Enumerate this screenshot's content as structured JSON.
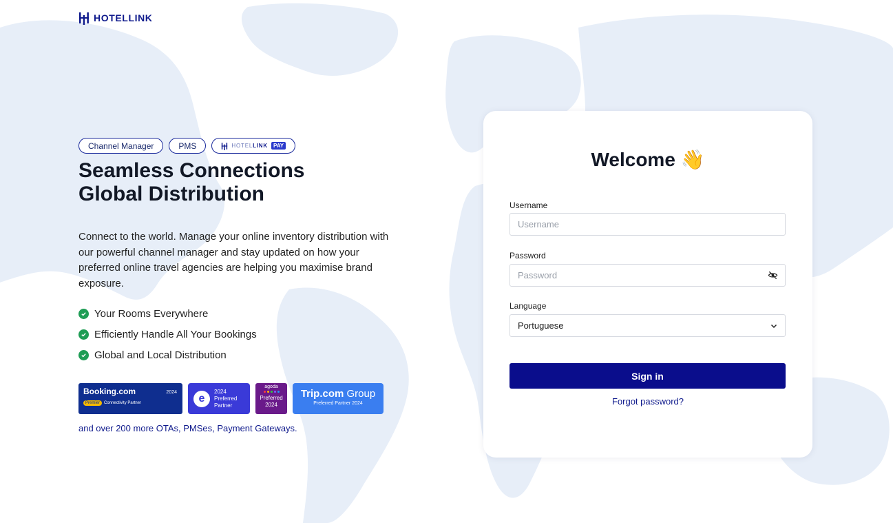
{
  "brand": {
    "name": "HOTELLINK"
  },
  "hero": {
    "pills": [
      "Channel Manager",
      "PMS"
    ],
    "pay_pill": {
      "brand_light": "HOTEL",
      "brand_bold": "LINK",
      "tag": "PAY"
    },
    "headline_line1": "Seamless Connections",
    "headline_line2": "Global Distribution",
    "description": "Connect to the world. Manage your online inventory distribution with our powerful channel manager and stay updated on how your preferred online travel agencies are helping you maximise brand exposure.",
    "features": [
      "Your Rooms Everywhere",
      "Efficiently Handle All Your Bookings",
      "Global and Local Distribution"
    ],
    "badges": {
      "booking": {
        "name": "Booking.com",
        "year": "2024",
        "tag": "Premier",
        "subtitle": "Connectivity Partner"
      },
      "expedia": {
        "letter": "e",
        "line1": "2024",
        "line2": "Preferred",
        "line3": "Partner"
      },
      "agoda": {
        "name": "agoda",
        "line1": "Preferred",
        "line2": "2024"
      },
      "trip": {
        "name_bold": "Trip.com",
        "name_light": " Group",
        "subtitle": "Preferred Partner 2024"
      }
    },
    "more_text": "and over 200 more OTAs, PMSes, Payment Gateways."
  },
  "login": {
    "title": "Welcome 👋",
    "username_label": "Username",
    "username_placeholder": "Username",
    "password_label": "Password",
    "password_placeholder": "Password",
    "language_label": "Language",
    "language_value": "Portuguese",
    "signin_label": "Sign in",
    "forgot_label": "Forgot password?"
  },
  "colors": {
    "primary": "#0a0d8c",
    "brand_text": "#0f1a8c",
    "success": "#1f9d55",
    "map": "#e7eef8"
  },
  "icons": [
    "hotellink-logo-icon",
    "check-icon",
    "eye-slash-icon",
    "chevron-down-icon",
    "world-map"
  ]
}
